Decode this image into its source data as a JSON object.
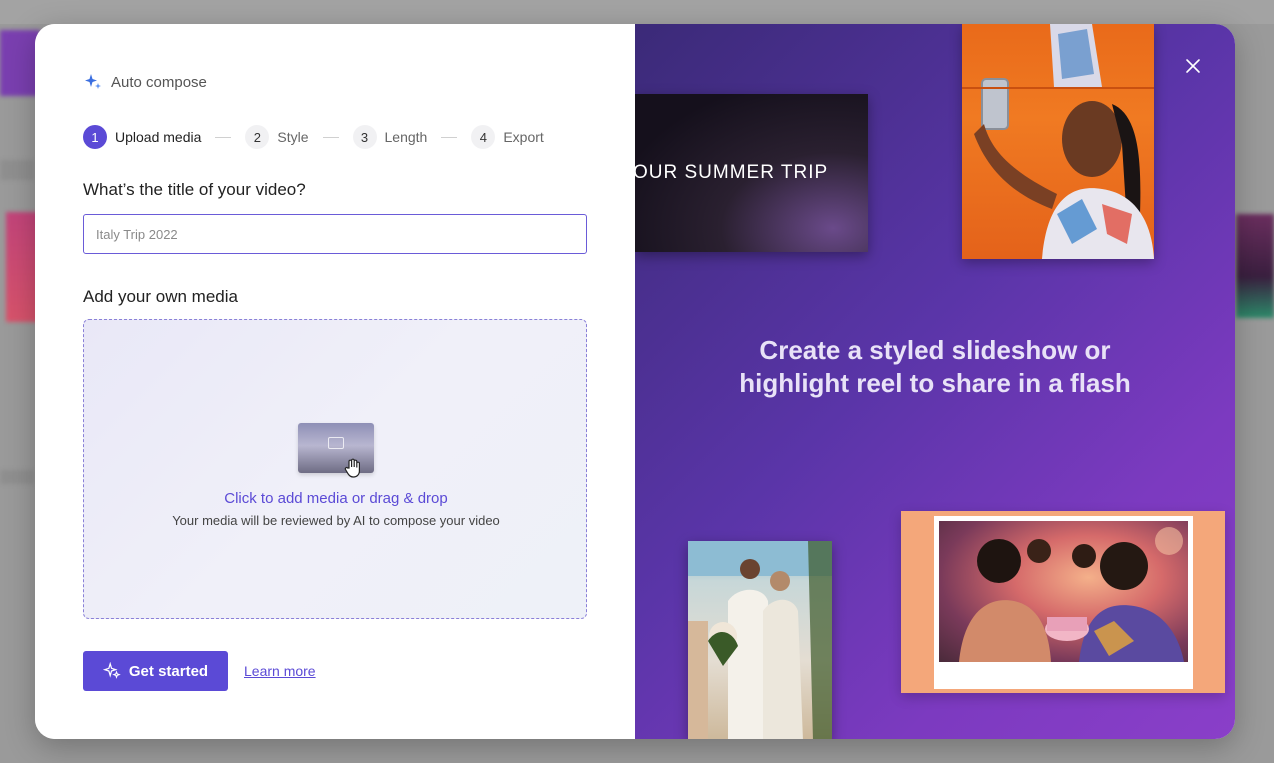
{
  "header": {
    "title": "Auto compose"
  },
  "steps": [
    {
      "num": "1",
      "label": "Upload media"
    },
    {
      "num": "2",
      "label": "Style"
    },
    {
      "num": "3",
      "label": "Length"
    },
    {
      "num": "4",
      "label": "Export"
    }
  ],
  "form": {
    "title_question": "What’s the title of your video?",
    "title_placeholder": "Italy Trip 2022",
    "media_label": "Add your own media"
  },
  "dropzone": {
    "main": "Click to add media or drag & drop",
    "sub": "Your media will be reviewed by AI to compose your video"
  },
  "actions": {
    "start": "Get started",
    "learn_more": "Learn more"
  },
  "promo": {
    "card_text": "OUR SUMMER TRIP",
    "tagline": "Create a styled slideshow or highlight reel to share in a flash"
  },
  "colors": {
    "accent": "#5b4ad6",
    "panel": "#5a35a8"
  }
}
